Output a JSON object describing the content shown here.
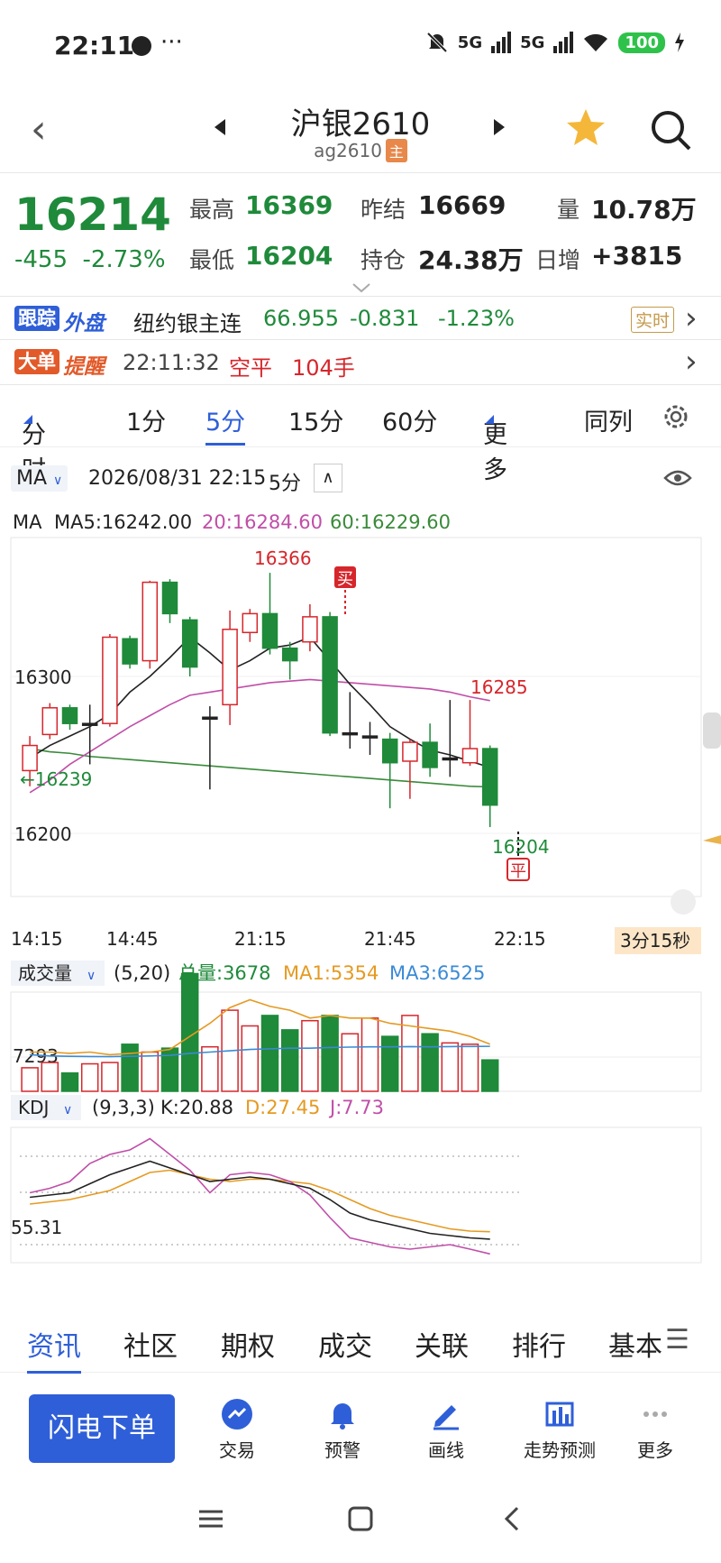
{
  "status_bar": {
    "time": "22:11",
    "more": "···",
    "signal1": "5G",
    "signal2": "5G",
    "battery": "100"
  },
  "header": {
    "title": "沪银2610",
    "code": "ag2610",
    "main_tag": "主"
  },
  "quote": {
    "last": "16214",
    "change": "-455",
    "change_pct": "-2.73%",
    "high_label": "最高",
    "high": "16369",
    "low_label": "最低",
    "low": "16204",
    "prev_settle_label": "昨结",
    "prev_settle": "16669",
    "oi_label": "持仓",
    "oi": "24.38万",
    "vol_label": "量",
    "vol": "10.78万",
    "daily_inc_label": "日增",
    "daily_inc": "+3815"
  },
  "tracker": {
    "tag1": "跟踪",
    "tag2": "外盘",
    "name": "纽约银主连",
    "price": "66.955",
    "change": "-0.831",
    "pct": "-1.23%",
    "realtime": "实时"
  },
  "big_order": {
    "tag1": "大单",
    "tag2": "提醒",
    "time": "22:11:32",
    "type": "空平",
    "qty": "104手"
  },
  "period_tabs": [
    "分时",
    "1分",
    "5分",
    "15分",
    "60分",
    "更多",
    "同列"
  ],
  "chart_header": {
    "indicator": "MA",
    "datetime": "2026/08/31 22:15",
    "period": "5分"
  },
  "ma_line": {
    "label": "MA",
    "ma5": "MA5:16242.00",
    "ma20": "20:16284.60",
    "ma60": "60:16229.60"
  },
  "price_labels": {
    "high": "16366",
    "level1": "16300",
    "level2": "16200",
    "mark_left": "←16239",
    "mark_right": "16285",
    "low": "16204",
    "buy": "买",
    "close": "平"
  },
  "time_axis": [
    "14:15",
    "14:45",
    "21:15",
    "21:45",
    "22:15"
  ],
  "countdown": "3分15秒",
  "volume_header": {
    "label": "成交量",
    "params": "(5,20)",
    "total": "总量:3678",
    "ma1": "MA1:5354",
    "ma3": "MA3:6525",
    "level": "7293"
  },
  "kdj_header": {
    "label": "KDJ",
    "params": "(9,3,3)",
    "k": "K:20.88",
    "d": "D:27.45",
    "j": "J:7.73",
    "level": "55.31"
  },
  "bottom_tabs": [
    "资讯",
    "社区",
    "期权",
    "成交",
    "关联",
    "排行",
    "基本"
  ],
  "actions": {
    "flash": "闪电下单",
    "trade": "交易",
    "alert": "预警",
    "draw": "画线",
    "predict": "走势预测",
    "more": "更多"
  },
  "colors": {
    "up": "#d6262b",
    "down": "#1f8a3a",
    "ma5": "#222222",
    "ma20": "#c04ea8",
    "ma60": "#3a8a3a",
    "accent": "#2f5fd8"
  },
  "chart_data": {
    "type": "candlestick",
    "candles": [
      {
        "o": 16240,
        "c": 16256,
        "h": 16262,
        "l": 16230
      },
      {
        "o": 16263,
        "c": 16280,
        "h": 16283,
        "l": 16260
      },
      {
        "o": 16280,
        "c": 16270,
        "h": 16282,
        "l": 16266
      },
      {
        "o": 16270,
        "c": 16270,
        "h": 16282,
        "l": 16244
      },
      {
        "o": 16270,
        "c": 16325,
        "h": 16327,
        "l": 16268
      },
      {
        "o": 16324,
        "c": 16308,
        "h": 16326,
        "l": 16305
      },
      {
        "o": 16310,
        "c": 16360,
        "h": 16361,
        "l": 16305
      },
      {
        "o": 16360,
        "c": 16340,
        "h": 16362,
        "l": 16334
      },
      {
        "o": 16336,
        "c": 16306,
        "h": 16338,
        "l": 16300
      },
      {
        "o": 16274,
        "c": 16274,
        "h": 16281,
        "l": 16228
      },
      {
        "o": 16282,
        "c": 16330,
        "h": 16342,
        "l": 16269
      },
      {
        "o": 16328,
        "c": 16340,
        "h": 16343,
        "l": 16322
      },
      {
        "o": 16340,
        "c": 16318,
        "h": 16366,
        "l": 16314
      },
      {
        "o": 16318,
        "c": 16310,
        "h": 16322,
        "l": 16298
      },
      {
        "o": 16322,
        "c": 16338,
        "h": 16346,
        "l": 16316
      },
      {
        "o": 16338,
        "c": 16264,
        "h": 16341,
        "l": 16262
      },
      {
        "o": 16264,
        "c": 16264,
        "h": 16290,
        "l": 16254
      },
      {
        "o": 16262,
        "c": 16262,
        "h": 16271,
        "l": 16250
      },
      {
        "o": 16260,
        "c": 16245,
        "h": 16264,
        "l": 16216
      },
      {
        "o": 16246,
        "c": 16258,
        "h": 16260,
        "l": 16222
      },
      {
        "o": 16258,
        "c": 16242,
        "h": 16270,
        "l": 16236
      },
      {
        "o": 16248,
        "c": 16248,
        "h": 16285,
        "l": 16236
      },
      {
        "o": 16245,
        "c": 16254,
        "h": 16285,
        "l": 16243
      },
      {
        "o": 16254,
        "c": 16218,
        "h": 16256,
        "l": 16204
      }
    ],
    "ma5": [
      16248,
      16256,
      16262,
      16268,
      16276,
      16290,
      16300,
      16312,
      16325,
      16315,
      16304,
      16310,
      16318,
      16320,
      16325,
      16310,
      16295,
      16282,
      16268,
      16260,
      16253,
      16250,
      16246,
      16242
    ],
    "ma20": [
      16226,
      16234,
      16244,
      16252,
      16260,
      16268,
      16275,
      16282,
      16288,
      16290,
      16292,
      16294,
      16296,
      16297,
      16298,
      16297,
      16296,
      16295,
      16294,
      16293,
      16292,
      16290,
      16287,
      16284.6
    ],
    "ma60": [
      16254,
      16252,
      16251,
      16249,
      16248,
      16247,
      16246,
      16245,
      16244,
      16243,
      16242,
      16241,
      16240,
      16239,
      16238,
      16237,
      16236,
      16235,
      16234,
      16233,
      16232,
      16231,
      16230,
      16229.6
    ],
    "volume": [
      180,
      220,
      140,
      210,
      220,
      360,
      300,
      330,
      900,
      340,
      620,
      500,
      580,
      470,
      540,
      580,
      440,
      560,
      420,
      580,
      440,
      370,
      360,
      240
    ],
    "vol_ma1": [
      300,
      300,
      290,
      300,
      280,
      290,
      300,
      320,
      420,
      520,
      640,
      700,
      650,
      620,
      560,
      580,
      560,
      560,
      520,
      500,
      480,
      460,
      420,
      360
    ],
    "vol_ma3": [
      280,
      270,
      268,
      266,
      265,
      268,
      270,
      275,
      290,
      300,
      310,
      320,
      325,
      330,
      330,
      335,
      338,
      340,
      340,
      342,
      340,
      342,
      343,
      344
    ],
    "kdj_k": [
      58,
      60,
      62,
      70,
      78,
      84,
      90,
      84,
      78,
      72,
      74,
      76,
      74,
      70,
      66,
      56,
      44,
      38,
      34,
      30,
      26,
      24,
      22,
      20.88
    ],
    "kdj_d": [
      52,
      54,
      56,
      60,
      64,
      72,
      80,
      82,
      78,
      74,
      72,
      74,
      74,
      72,
      70,
      64,
      56,
      48,
      42,
      38,
      34,
      30,
      28,
      27.45
    ],
    "kdj_j": [
      62,
      66,
      72,
      88,
      96,
      100,
      110,
      96,
      82,
      62,
      78,
      80,
      78,
      72,
      60,
      40,
      22,
      18,
      14,
      12,
      14,
      16,
      12,
      7.73
    ]
  }
}
